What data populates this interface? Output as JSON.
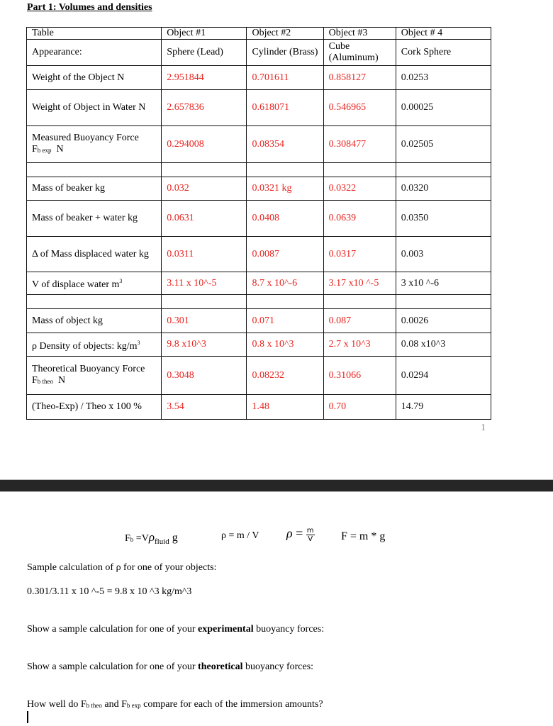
{
  "title": "Part 1: Volumes and densities",
  "table": {
    "header": [
      "Table",
      "Object #1",
      "Object #2",
      "Object #3",
      "Object # 4"
    ],
    "appearance": {
      "label": "Appearance:",
      "values": [
        "Sphere (Lead)",
        "Cylinder (Brass)",
        "Cube (Aluminum)",
        "Cork Sphere"
      ]
    },
    "rows": {
      "weight": {
        "label": "Weight of the Object N",
        "values": [
          "2.951844",
          "0.701611",
          "0.858127",
          "0.0253"
        ]
      },
      "weight_water": {
        "label": "Weight of Object in Water N",
        "values": [
          "2.657836",
          "0.618071",
          "0.546965",
          "0.00025"
        ]
      },
      "buoy_exp": {
        "label": "Measured Buoyancy Force",
        "sym": "F",
        "sub": "b exp",
        "unit": "N",
        "values": [
          "0.294008",
          "0.08354",
          "0.308477",
          "0.02505"
        ]
      },
      "mass_beaker": {
        "label": "Mass of beaker kg",
        "values": [
          "0.032",
          "0.0321 kg",
          "0.0322",
          "0.0320"
        ]
      },
      "mass_beaker_water": {
        "label": "Mass of beaker + water kg",
        "values": [
          "0.0631",
          "0.0408",
          "0.0639",
          "0.0350"
        ]
      },
      "delta_mass": {
        "label": "Δ of  Mass displaced water kg",
        "values": [
          "0.0311",
          "0.0087",
          "0.0317",
          "0.003"
        ]
      },
      "volume": {
        "label": "V of displace water m",
        "exp": "3",
        "values": [
          "3.11 x 10^-5",
          "8.7 x 10^-6",
          "3.17 x10 ^-5",
          "3 x10 ^-6"
        ]
      },
      "mass_object": {
        "label": "Mass of object  kg",
        "values": [
          "0.301",
          "0.071",
          "0.087",
          "0.0026"
        ]
      },
      "density": {
        "label": "ρ  Density of objects: kg/m",
        "exp": "3",
        "values": [
          "9.8 x10^3",
          "0.8 x 10^3",
          "2.7 x 10^3",
          "0.08 x10^3"
        ]
      },
      "buoy_theo": {
        "label": "Theoretical Buoyancy Force",
        "sym": "F",
        "sub": "b theo",
        "unit": "N",
        "values": [
          "0.3048",
          "0.08232",
          "0.31066",
          "0.0294"
        ]
      },
      "percent": {
        "label": "(Theo-Exp) / Theo x 100 %",
        "values": [
          "3.54",
          "1.48",
          "0.70",
          "14.79"
        ]
      }
    }
  },
  "page_number": "1",
  "formulas": {
    "f1": {
      "lhs": "F",
      "lhs_sub": "b",
      "eq": " =V",
      "rho": "ρ",
      "rho_sub": "fluid",
      "tail": " g"
    },
    "f2": "ρ = m / V",
    "f3": {
      "rho": "ρ",
      "eq": " = ",
      "num": "m",
      "den": "V"
    },
    "f4": "F = m * g"
  },
  "sample_density_label": "Sample calculation of ρ for one of your objects:",
  "sample_density_calc": "0.301/3.11 x 10 ^-5 = 9.8 x 10 ^3 kg/m^3",
  "prompt_exp": {
    "pre": "Show a sample calculation for one of your ",
    "bold": "experimental",
    "post": " buoyancy forces:"
  },
  "prompt_theo": {
    "pre": "Show a sample calculation for one of your ",
    "bold": "theoretical",
    "post": " buoyancy forces:"
  },
  "prompt_compare": {
    "pre": "How well do ",
    "f": "F",
    "sub1": "b theo",
    "mid": " and ",
    "sub2": "b exp",
    "post": " compare for each of the immersion amounts?"
  },
  "colors": {
    "entered_value": "#e8231f",
    "separator": "#262626"
  }
}
